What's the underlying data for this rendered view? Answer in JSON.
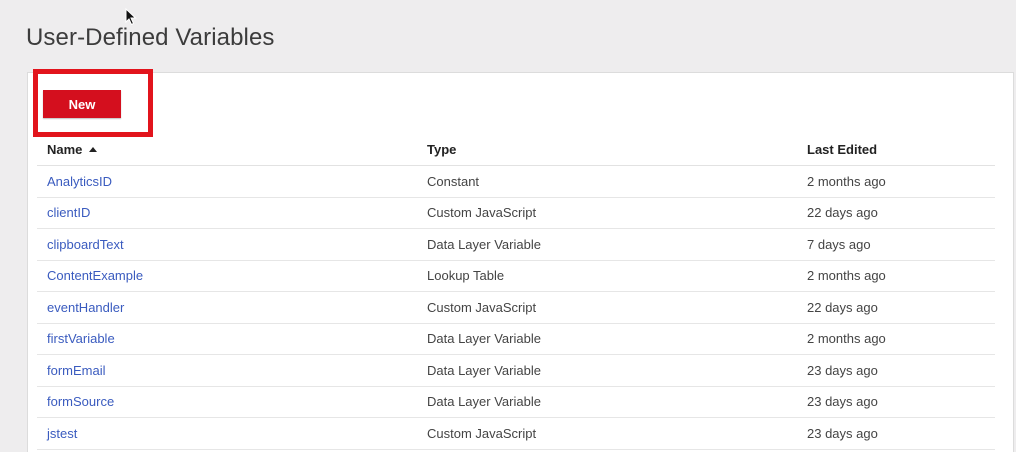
{
  "page": {
    "title": "User-Defined Variables"
  },
  "toolbar": {
    "new_label": "New"
  },
  "table": {
    "columns": {
      "name": "Name",
      "type": "Type",
      "last_edited": "Last Edited"
    },
    "sort": {
      "column": "name",
      "direction": "ascending",
      "icon": "sort-ascending-icon"
    },
    "rows": [
      {
        "name": "AnalyticsID",
        "type": "Constant",
        "last_edited": "2 months ago"
      },
      {
        "name": "clientID",
        "type": "Custom JavaScript",
        "last_edited": "22 days ago"
      },
      {
        "name": "clipboardText",
        "type": "Data Layer Variable",
        "last_edited": "7 days ago"
      },
      {
        "name": "ContentExample",
        "type": "Lookup Table",
        "last_edited": "2 months ago"
      },
      {
        "name": "eventHandler",
        "type": "Custom JavaScript",
        "last_edited": "22 days ago"
      },
      {
        "name": "firstVariable",
        "type": "Data Layer Variable",
        "last_edited": "2 months ago"
      },
      {
        "name": "formEmail",
        "type": "Data Layer Variable",
        "last_edited": "23 days ago"
      },
      {
        "name": "formSource",
        "type": "Data Layer Variable",
        "last_edited": "23 days ago"
      },
      {
        "name": "jstest",
        "type": "Custom JavaScript",
        "last_edited": "23 days ago"
      }
    ]
  },
  "colors": {
    "button_red": "#d40f1e",
    "highlight_red": "#e2141c",
    "link_blue": "#3a5bbf",
    "background": "#eeedee"
  }
}
